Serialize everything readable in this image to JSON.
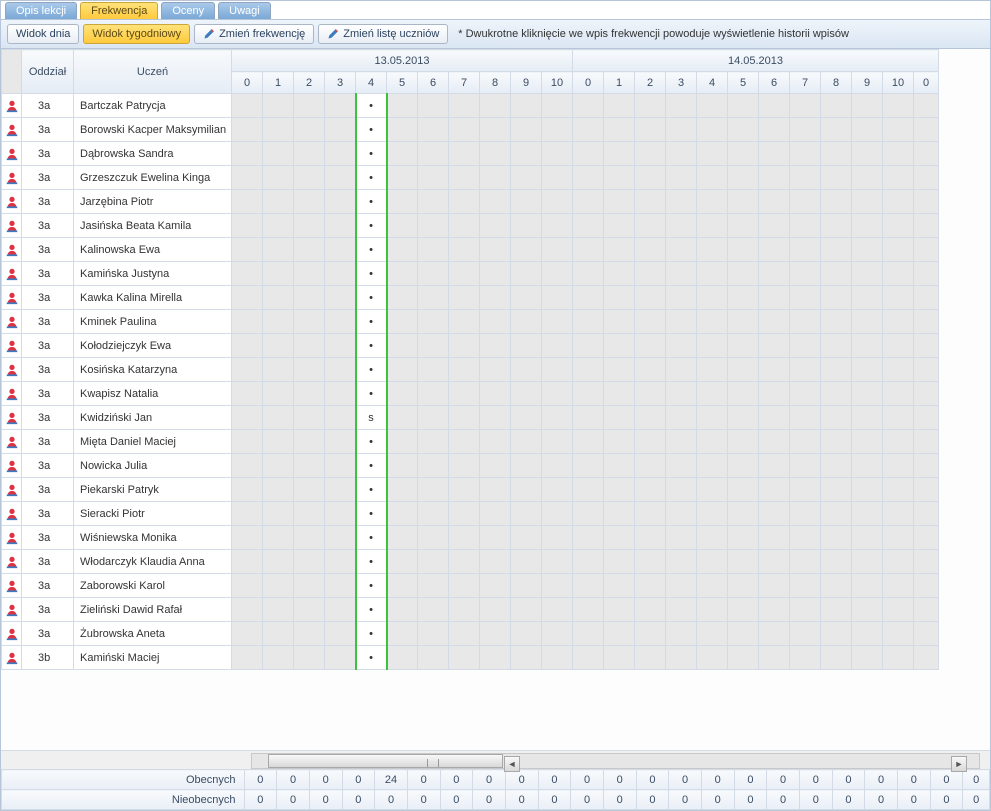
{
  "tabs": {
    "opis": {
      "label": "Opis lekcji"
    },
    "frekw": {
      "label": "Frekwencja"
    },
    "oceny": {
      "label": "Oceny"
    },
    "uwagi": {
      "label": "Uwagi"
    },
    "active": "frekw"
  },
  "toolbar": {
    "widok_dnia": "Widok dnia",
    "widok_tyg": "Widok tygodniowy",
    "zmien_frekw": "Zmień frekwencję",
    "zmien_liste": "Zmień listę uczniów",
    "active": "widok_tyg",
    "hint": "* Dwukrotne kliknięcie we wpis frekwencji powoduje wyświetlenie historii wpisów"
  },
  "headers": {
    "oddzial": "Oddział",
    "uczen": "Uczeń",
    "days": [
      {
        "date": "13.05.2013",
        "periods": [
          "0",
          "1",
          "2",
          "3",
          "4",
          "5",
          "6",
          "7",
          "8",
          "9",
          "10"
        ]
      },
      {
        "date": "14.05.2013",
        "periods": [
          "0",
          "1",
          "2",
          "3",
          "4",
          "5",
          "6",
          "7",
          "8",
          "9",
          "10",
          "0"
        ]
      }
    ]
  },
  "active_period": {
    "day": 0,
    "period": 4
  },
  "students": [
    {
      "oddz": "3a",
      "name": "Bartczak Patrycja",
      "mark": "•"
    },
    {
      "oddz": "3a",
      "name": "Borowski Kacper Maksymilian",
      "mark": "•"
    },
    {
      "oddz": "3a",
      "name": "Dąbrowska Sandra",
      "mark": "•"
    },
    {
      "oddz": "3a",
      "name": "Grzeszczuk Ewelina Kinga",
      "mark": "•"
    },
    {
      "oddz": "3a",
      "name": "Jarzębina Piotr",
      "mark": "•"
    },
    {
      "oddz": "3a",
      "name": "Jasińska Beata Kamila",
      "mark": "•"
    },
    {
      "oddz": "3a",
      "name": "Kalinowska Ewa",
      "mark": "•"
    },
    {
      "oddz": "3a",
      "name": "Kamińska Justyna",
      "mark": "•"
    },
    {
      "oddz": "3a",
      "name": "Kawka Kalina Mirella",
      "mark": "•"
    },
    {
      "oddz": "3a",
      "name": "Kminek Paulina",
      "mark": "•"
    },
    {
      "oddz": "3a",
      "name": "Kołodziejczyk Ewa",
      "mark": "•"
    },
    {
      "oddz": "3a",
      "name": "Kosińska Katarzyna",
      "mark": "•"
    },
    {
      "oddz": "3a",
      "name": "Kwapisz Natalia",
      "mark": "•"
    },
    {
      "oddz": "3a",
      "name": "Kwidziński Jan",
      "mark": "s"
    },
    {
      "oddz": "3a",
      "name": "Mięta Daniel Maciej",
      "mark": "•"
    },
    {
      "oddz": "3a",
      "name": "Nowicka Julia",
      "mark": "•"
    },
    {
      "oddz": "3a",
      "name": "Piekarski Patryk",
      "mark": "•"
    },
    {
      "oddz": "3a",
      "name": "Sieracki Piotr",
      "mark": "•"
    },
    {
      "oddz": "3a",
      "name": "Wiśniewska Monika",
      "mark": "•"
    },
    {
      "oddz": "3a",
      "name": "Włodarczyk Klaudia Anna",
      "mark": "•"
    },
    {
      "oddz": "3a",
      "name": "Zaborowski Karol",
      "mark": "•"
    },
    {
      "oddz": "3a",
      "name": "Zieliński Dawid Rafał",
      "mark": "•"
    },
    {
      "oddz": "3a",
      "name": "Żubrowska Aneta",
      "mark": "•"
    },
    {
      "oddz": "3b",
      "name": "Kamiński Maciej",
      "mark": "•"
    }
  ],
  "summary": {
    "obecnych_label": "Obecnych",
    "nieobecnych_label": "Nieobecnych",
    "obecnych": [
      0,
      0,
      0,
      0,
      24,
      0,
      0,
      0,
      0,
      0,
      0,
      0,
      0,
      0,
      0,
      0,
      0,
      0,
      0,
      0,
      0,
      0,
      0
    ],
    "nieobecnych": [
      0,
      0,
      0,
      0,
      0,
      0,
      0,
      0,
      0,
      0,
      0,
      0,
      0,
      0,
      0,
      0,
      0,
      0,
      0,
      0,
      0,
      0,
      0
    ]
  }
}
